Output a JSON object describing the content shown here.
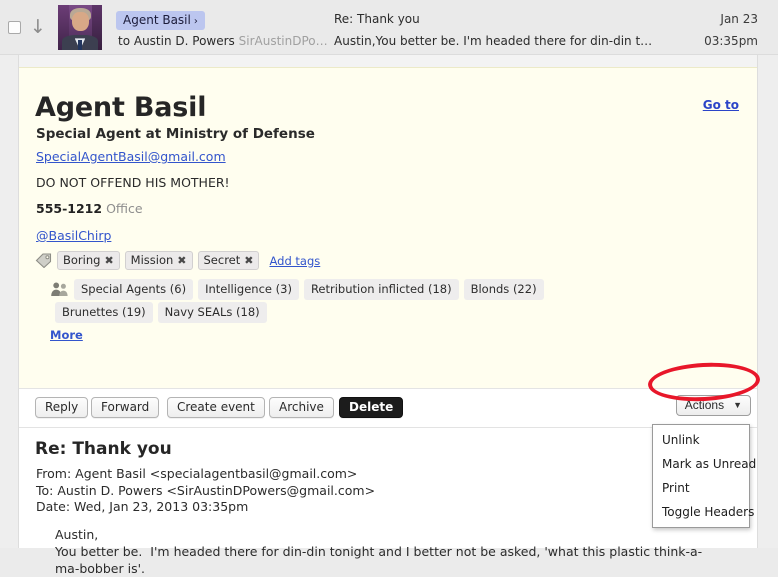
{
  "list_row": {
    "checkbox_checked": false,
    "arrow_icon": "down-arrow-icon",
    "avatar_name": "avatar",
    "sender": "Agent Basil",
    "sender_chevron": "›",
    "recipient_prefix": "to Austin D. Powers",
    "recipient_muted": "SirAustinDPo…",
    "subject": "Re: Thank you",
    "snippet": "Austin,You better be.  I'm headed there for din-din t…",
    "date": "Jan 23",
    "time": "03:35pm"
  },
  "contact": {
    "goto_label": "Go to",
    "name": "Agent Basil",
    "title": "Special Agent at Ministry of Defense",
    "email": "SpecialAgentBasil@gmail.com",
    "note": "DO NOT OFFEND HIS MOTHER!",
    "phone_number": "555-1212",
    "phone_label": "Office",
    "handle": "@BasilChirp",
    "tags": [
      "Boring",
      "Mission",
      "Secret"
    ],
    "tag_remove_glyph": "✖",
    "add_tags_label": "Add tags",
    "groups_row1": [
      "Special Agents (6)",
      "Intelligence  (3)",
      "Retribution inflicted (18)",
      "Blonds (22)"
    ],
    "groups_row2": [
      "Brunettes (19)",
      "Navy SEALs (18)"
    ],
    "more_label": "More"
  },
  "toolbar": {
    "reply_label": "Reply",
    "forward_label": "Forward",
    "create_event_label": "Create event",
    "archive_label": "Archive",
    "delete_label": "Delete",
    "actions_label": "Actions",
    "actions_caret": "▼"
  },
  "actions_menu": {
    "items": [
      "Unlink",
      "Mark as Unread",
      "Print",
      "Toggle Headers"
    ]
  },
  "message": {
    "subject": "Re: Thank you",
    "from_line": "From: Agent Basil <specialagentbasil@gmail.com>",
    "to_line": "To: Austin D. Powers <SirAustinDPowers@gmail.com>",
    "date_line": "Date: Wed, Jan 23, 2013 03:35pm",
    "body": "Austin,\nYou better be.  I'm headed there for din-din tonight and I better not be asked, 'what this plastic think-a-ma-bobber is'."
  },
  "colors": {
    "card_background": "#fffeef",
    "link": "#3355cc",
    "sender_pill": "#bcc6ef",
    "annotation": "#e8172a",
    "delete_button": "#1c1c1c"
  }
}
